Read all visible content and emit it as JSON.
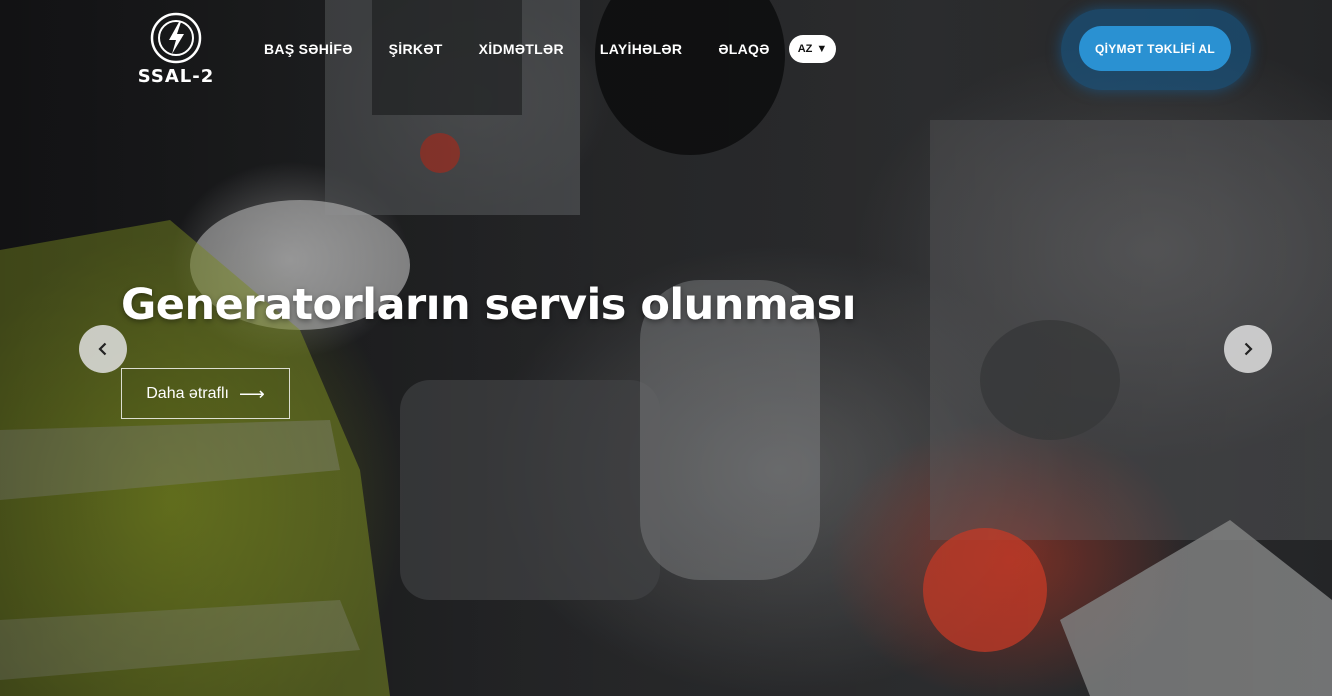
{
  "brand": {
    "name": "SSAL-2"
  },
  "nav": {
    "items": [
      {
        "label": "BAŞ SƏHİFƏ"
      },
      {
        "label": "ŞİRKƏT"
      },
      {
        "label": "XİDMƏTLƏR"
      },
      {
        "label": "LAYİHƏLƏR"
      },
      {
        "label": "ƏLAQƏ"
      }
    ],
    "language": {
      "selected": "AZ",
      "icon": "caret-down-icon"
    }
  },
  "cta": {
    "label": "QİYMƏT TƏKLİFİ AL",
    "color": "#2a91d2"
  },
  "hero": {
    "title": "Generatorların servis olunması",
    "more_label": "Daha ətraflı",
    "more_icon": "arrow-right-icon",
    "prev_icon": "chevron-left-icon",
    "next_icon": "chevron-right-icon"
  }
}
